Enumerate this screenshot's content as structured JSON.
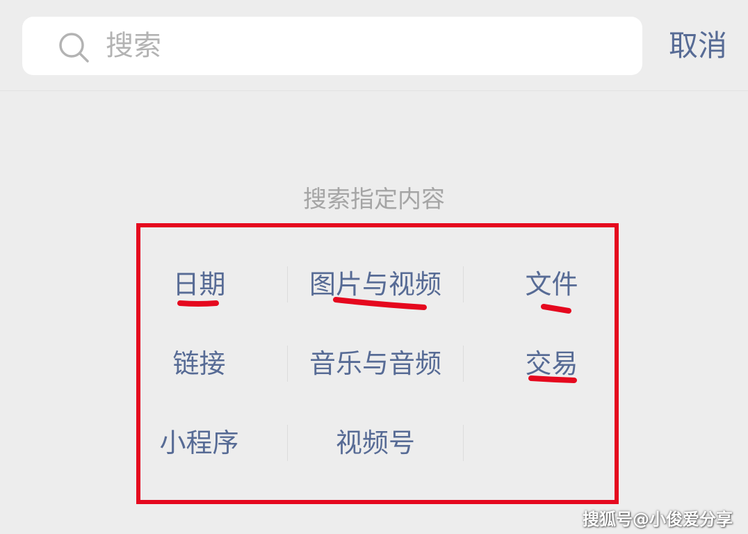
{
  "search": {
    "placeholder": "搜索",
    "cancel_label": "取消"
  },
  "section": {
    "title": "搜索指定内容"
  },
  "categories": {
    "rows": [
      [
        "日期",
        "图片与视频",
        "文件"
      ],
      [
        "链接",
        "音乐与音频",
        "交易"
      ],
      [
        "小程序",
        "视频号",
        ""
      ]
    ]
  },
  "colors": {
    "background": "#ededed",
    "search_box": "#ffffff",
    "link_blue": "#576b95",
    "placeholder_gray": "#b3b3b3",
    "title_gray": "#a5a5a5",
    "annotation_red": "#e5081e"
  },
  "icons": {
    "search": "search-icon"
  },
  "watermark": {
    "text": "搜狐号@小俊爱分享"
  }
}
